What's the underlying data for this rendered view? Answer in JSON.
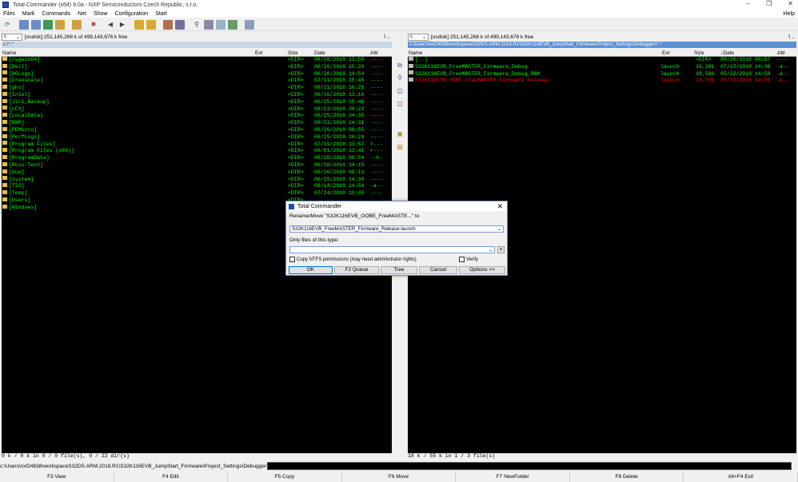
{
  "window": {
    "title": "Total Commander (x64) 9.0a - NXP Semiconductors Czech Republic, s.r.o.",
    "controls": [
      "–",
      "❐",
      "✕"
    ]
  },
  "menu": {
    "items": [
      "Files",
      "Mark",
      "Commands",
      "Net",
      "Show",
      "Configuration",
      "Start"
    ],
    "help": "Help"
  },
  "left": {
    "drive": "c",
    "drive_label": "[osdisk]  251,145,268 k of 499,143,676 k free",
    "path": "c:\\*.*",
    "columns": {
      "name": "Name",
      "ext": "Ext",
      "size": "Size",
      "date": "Date",
      "attr": "Attr"
    },
    "rows": [
      {
        "name": "[cygwin64]",
        "size": "<DIR>",
        "date": "08/28/2018 13:50",
        "attr": "----"
      },
      {
        "name": "[Dell]",
        "size": "<DIR>",
        "date": "06/26/2018 15:20",
        "attr": "----"
      },
      {
        "name": "[DGLogs]",
        "size": "<DIR>",
        "date": "06/26/2018 14:54",
        "attr": "----"
      },
      {
        "name": "[Freescale]",
        "size": "<DIR>",
        "date": "07/11/2018 15:45",
        "attr": "----"
      },
      {
        "name": "[ghs]",
        "size": "<DIR>",
        "date": "08/21/2018 10:21",
        "attr": "----"
      },
      {
        "name": "[Intel]",
        "size": "<DIR>",
        "date": "06/26/2018 13:16",
        "attr": "----"
      },
      {
        "name": "[Jiri_Backup]",
        "size": "<DIR>",
        "date": "06/25/2018 15:41",
        "attr": "----"
      },
      {
        "name": "[LFS]",
        "size": "<DIR>",
        "date": "08/23/2018 20:22",
        "attr": "----"
      },
      {
        "name": "[LocalData]",
        "size": "<DIR>",
        "date": "06/25/2018 14:35",
        "attr": "----"
      },
      {
        "name": "[NXP]",
        "size": "<DIR>",
        "date": "08/21/2018 14:31",
        "attr": "----"
      },
      {
        "name": "[PEMicro]",
        "size": "<DIR>",
        "date": "06/26/2018 08:55",
        "attr": "----"
      },
      {
        "name": "[PerfLogs]",
        "size": "<DIR>",
        "date": "06/25/2018 16:29",
        "attr": "----"
      },
      {
        "name": "[Program Files]",
        "size": "<DIR>",
        "date": "07/19/2018 13:57",
        "attr": "r---"
      },
      {
        "name": "[Program Files (x86)]",
        "size": "<DIR>",
        "date": "08/01/2018 13:41",
        "attr": "r---"
      },
      {
        "name": "[ProgramData]",
        "size": "<DIR>",
        "date": "08/28/2018 08:54",
        "attr": "--h-"
      },
      {
        "name": "[Ross-Tech]",
        "size": "<DIR>",
        "date": "06/26/2018 14:15",
        "attr": "----"
      },
      {
        "name": "[Sun]",
        "size": "<DIR>",
        "date": "06/26/2018 09:13",
        "attr": "----"
      },
      {
        "name": "[system]",
        "size": "<DIR>",
        "date": "06/25/2018 14:38",
        "attr": "----"
      },
      {
        "name": "[T32]",
        "size": "<DIR>",
        "date": "08/14/2018 14:54",
        "attr": "-a--"
      },
      {
        "name": "[Temp]",
        "size": "<DIR>",
        "date": "07/24/2018 13:45",
        "attr": "----"
      },
      {
        "name": "[Users]",
        "size": "<DIR>",
        "date": "",
        "attr": ""
      },
      {
        "name": "[Windows]",
        "size": "<DIR>",
        "date": "",
        "attr": ""
      }
    ],
    "status": "0 k / 0 k in 0 / 0 file(s), 0 / 22 dir(s)"
  },
  "right": {
    "drive": "c",
    "drive_label": "[osdisk]  251,145,268 k of 499,143,676 k free",
    "path": "c:\\Users\\nxf24838\\workspaceS32DS.ARM.2018.R1\\S32K116EVB_JumpStart_Firmware\\Project_Settings\\Debugger\\*.*",
    "columns": {
      "name": "Name",
      "ext": "Ext",
      "size": "Size",
      "date": "↓Date",
      "attr": "Attr"
    },
    "rows": [
      {
        "name": "[..]",
        "ext": "",
        "size": "<DIR>",
        "date": "08/28/2018 08:57",
        "attr": "----",
        "color": "#00ff00"
      },
      {
        "name": "S32K116EVB_FreeMASTER_Firmware_Debug",
        "ext": "launch",
        "size": "19,281",
        "date": "07/27/2018 14:38",
        "attr": "-a--",
        "color": "#00ff00"
      },
      {
        "name": "S32K116EVB_FreeMASTER_Firmware_Debug_RAM",
        "ext": "launch",
        "size": "18,584",
        "date": "05/22/2018 14:50",
        "attr": "-a--",
        "color": "#00ff00"
      },
      {
        "name": "S32K116EVB_OOBE_FreeMASTER_Firmware_Release",
        "ext": "launch",
        "size": "18,591",
        "date": "05/22/2018 14:50",
        "attr": "-a--",
        "color": "#ff0000"
      }
    ],
    "status": "18 k / 55 k in 1 / 3 file(s)"
  },
  "cmdline": {
    "path": "c:\\Users\\nxf24838\\workspaceS32DS.ARM.2018.R1\\S32K116EVB_JumpStart_Firmware\\Project_Settings\\Debugger>"
  },
  "fkeys": [
    "F3 View",
    "F4 Edit",
    "F5 Copy",
    "F6 Move",
    "F7 NewFolder",
    "F8 Delete",
    "Alt+F4 Exit"
  ],
  "dialog": {
    "title": "Total Commander",
    "prompt": "Rename/Move \"S32K116EVB_OOBE_FreeMASTE...\" to",
    "target_value": "S32K116EVB_FreeMASTER_Firmware_Release.launch",
    "filter_label": "Only files of this type:",
    "filter_value": "",
    "copy_ntfs_label": "Copy NTFS permissions (may need administrator rights)",
    "verify_label": "Verify",
    "buttons": [
      "OK",
      "F2 Queue",
      "Tree",
      "Cancel",
      "Options >>"
    ]
  },
  "colors": {
    "panel_bg": "#000000",
    "file_fg": "#00ff00",
    "marked_fg": "#ff0000",
    "active_path_bg": "#5b8fd6"
  }
}
